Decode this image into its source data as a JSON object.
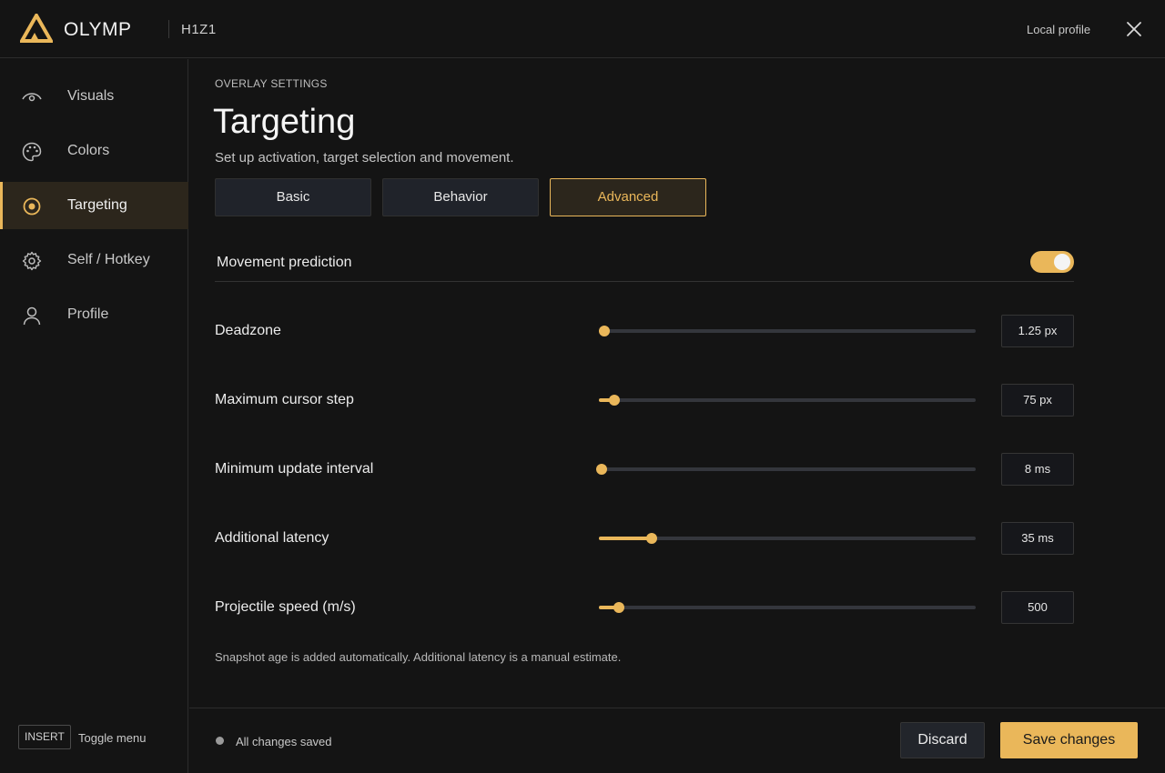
{
  "header": {
    "logo_text": "OLYMP",
    "game": "H1Z1",
    "profile": "Local profile",
    "accent": "#eab75a"
  },
  "sidebar": {
    "items": [
      {
        "label": "Visuals",
        "icon": "eye-icon",
        "active": false
      },
      {
        "label": "Colors",
        "icon": "palette-icon",
        "active": false
      },
      {
        "label": "Targeting",
        "icon": "target-icon",
        "active": true
      },
      {
        "label": "Self / Hotkey",
        "icon": "gear-icon",
        "active": false
      },
      {
        "label": "Profile",
        "icon": "user-icon",
        "active": false
      }
    ],
    "hotkey": "INSERT",
    "hotkey_label": "Toggle menu"
  },
  "main": {
    "kicker": "OVERLAY SETTINGS",
    "title": "Targeting",
    "subtitle": "Set up activation, target selection and movement.",
    "tabs": [
      {
        "label": "Basic",
        "active": false
      },
      {
        "label": "Behavior",
        "active": false
      },
      {
        "label": "Advanced",
        "active": true
      }
    ],
    "toggle": {
      "label": "Movement prediction",
      "on": true
    },
    "settings": [
      {
        "label": "Deadzone",
        "value": "1.25 px",
        "fraction": 0.015
      },
      {
        "label": "Maximum cursor step",
        "value": "75 px",
        "fraction": 0.04
      },
      {
        "label": "Minimum update interval",
        "value": "8 ms",
        "fraction": 0.008
      },
      {
        "label": "Additional latency",
        "value": "35 ms",
        "fraction": 0.14
      },
      {
        "label": "Projectile speed (m/s)",
        "value": "500",
        "fraction": 0.053
      }
    ],
    "footnote": "Snapshot age is added automatically. Additional latency is a manual estimate."
  },
  "footer": {
    "status": "All changes saved",
    "discard": "Discard",
    "save": "Save changes"
  }
}
